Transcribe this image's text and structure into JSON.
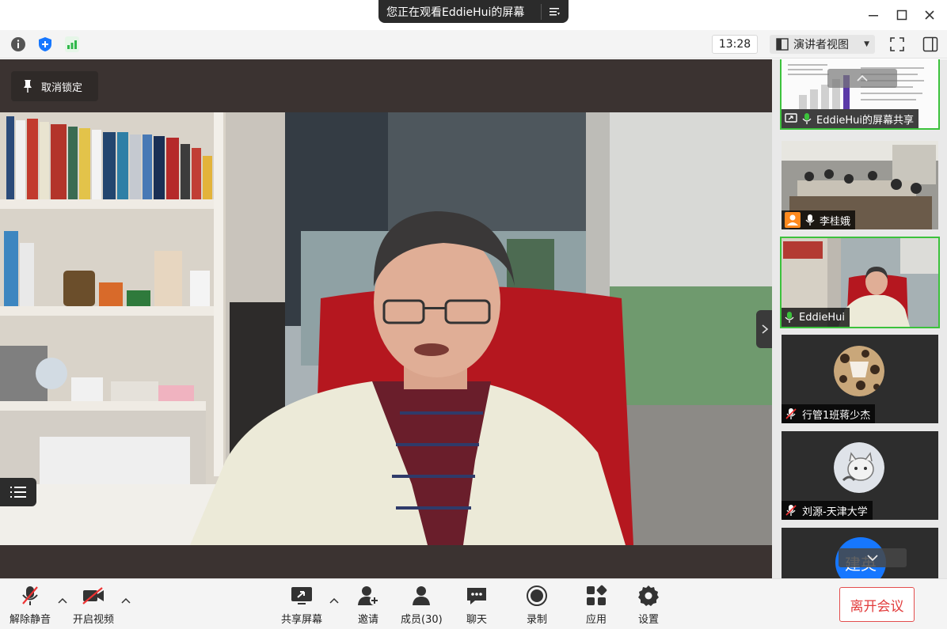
{
  "titlebar": {
    "share_notice": "您正在观看EddieHui的屏幕"
  },
  "toolbar": {
    "time": "13:28",
    "view_mode": "演讲者视图"
  },
  "stage": {
    "unlock_label": "取消锁定"
  },
  "participants": [
    {
      "label": "EddieHui的屏幕共享",
      "mic": "on",
      "active": true
    },
    {
      "label": "李桂娥",
      "mic": "on",
      "active": false
    },
    {
      "label": "EddieHui",
      "mic": "on",
      "active": true
    },
    {
      "label": "行管1班蒋少杰",
      "mic": "muted",
      "active": false
    },
    {
      "label": "刘源-天津大学",
      "mic": "muted",
      "active": false
    },
    {
      "label": "",
      "avatar_text": "建英",
      "active": false
    }
  ],
  "bottombar": {
    "unmute": "解除静音",
    "start_video": "开启视频",
    "share_screen": "共享屏幕",
    "invite": "邀请",
    "members": "成员(30)",
    "chat": "聊天",
    "record": "录制",
    "apps": "应用",
    "settings": "设置",
    "leave": "离开会议"
  },
  "colors": {
    "accent_green": "#3cc23c",
    "leave_red": "#e23b3b",
    "avatar_blue": "#1677ff"
  }
}
